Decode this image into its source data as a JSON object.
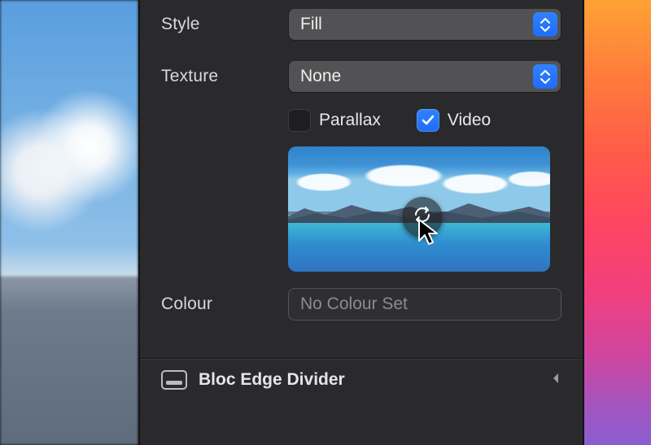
{
  "style": {
    "label": "Style",
    "value": "Fill"
  },
  "texture": {
    "label": "Texture",
    "value": "None"
  },
  "parallax": {
    "label": "Parallax",
    "checked": false
  },
  "video": {
    "label": "Video",
    "checked": true
  },
  "colour": {
    "label": "Colour",
    "placeholder": "No Colour Set"
  },
  "section": {
    "title": "Bloc Edge Divider"
  }
}
